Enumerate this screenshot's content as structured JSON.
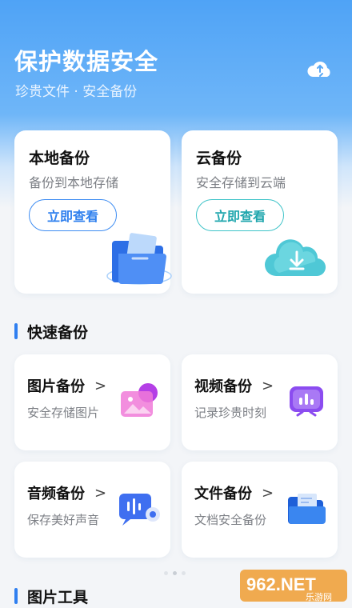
{
  "hero": {
    "title": "保护数据安全",
    "subtitle": "珍贵文件 · 安全备份",
    "sync_icon": "cloud-sync-icon"
  },
  "backup_cards": [
    {
      "title": "本地备份",
      "subtitle": "备份到本地存储",
      "button": "立即查看",
      "icon": "folder-icon",
      "accent": "#3d8cf2"
    },
    {
      "title": "云备份",
      "subtitle": "安全存储到云端",
      "button": "立即查看",
      "icon": "cloud-download-icon",
      "accent": "#3ec3c8"
    }
  ],
  "quick_section": {
    "title": "快速备份"
  },
  "quick_items": [
    {
      "title": "图片备份",
      "chevron": ">",
      "subtitle": "安全存储图片",
      "icon": "image-icon"
    },
    {
      "title": "视频备份",
      "chevron": ">",
      "subtitle": "记录珍贵时刻",
      "icon": "video-icon"
    },
    {
      "title": "音频备份",
      "chevron": ">",
      "subtitle": "保存美好声音",
      "icon": "audio-icon"
    },
    {
      "title": "文件备份",
      "chevron": ">",
      "subtitle": "文档安全备份",
      "icon": "file-folder-icon"
    }
  ],
  "tools_section": {
    "title": "图片工具"
  },
  "watermark": {
    "text": "962.NET",
    "sub": "乐游网"
  },
  "colors": {
    "primary": "#2f7ff0",
    "teal": "#3ec3c8",
    "hero_top": "#4fa3f6"
  }
}
